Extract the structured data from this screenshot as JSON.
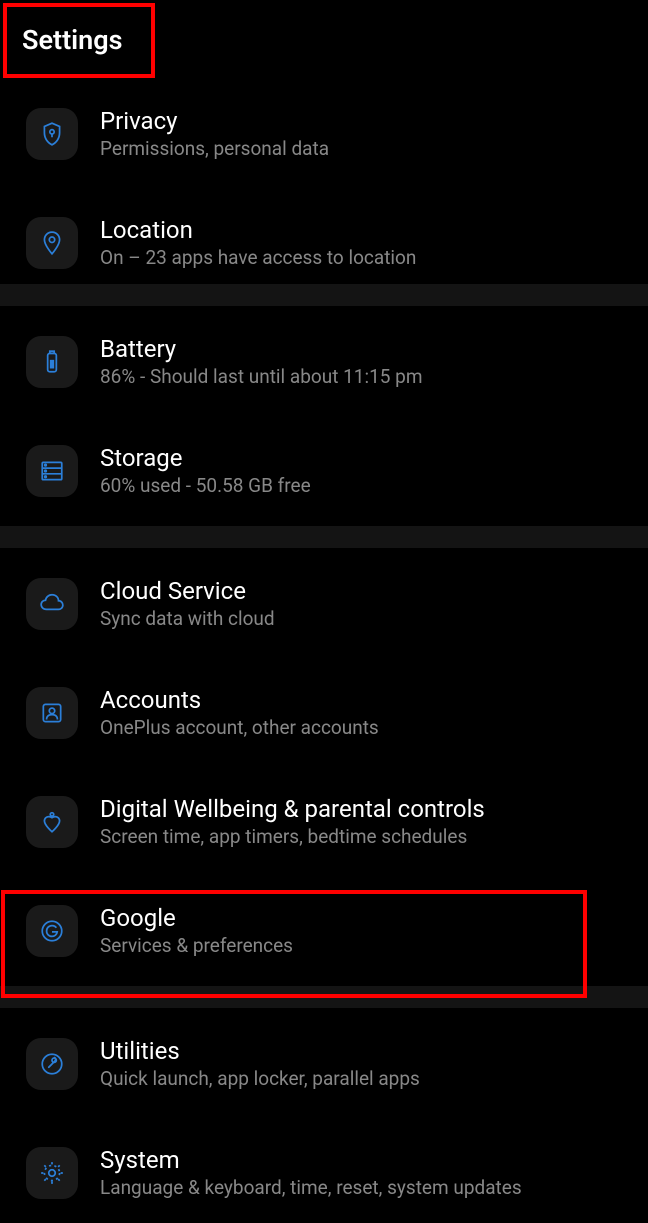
{
  "header": {
    "title": "Settings"
  },
  "groups": [
    {
      "items": [
        {
          "icon": "shield-keyhole",
          "title": "Privacy",
          "subtitle": "Permissions, personal data"
        },
        {
          "icon": "location-pin",
          "title": "Location",
          "subtitle": "On – 23 apps have access to location"
        }
      ]
    },
    {
      "items": [
        {
          "icon": "battery",
          "title": "Battery",
          "subtitle": "86% - Should last until about 11:15 pm"
        },
        {
          "icon": "storage",
          "title": "Storage",
          "subtitle": "60% used - 50.58 GB free"
        }
      ]
    },
    {
      "items": [
        {
          "icon": "cloud",
          "title": "Cloud Service",
          "subtitle": "Sync data with cloud"
        },
        {
          "icon": "accounts",
          "title": "Accounts",
          "subtitle": "OnePlus account, other accounts"
        },
        {
          "icon": "wellbeing",
          "title": "Digital Wellbeing & parental controls",
          "subtitle": "Screen time, app timers, bedtime schedules"
        },
        {
          "icon": "google",
          "title": "Google",
          "subtitle": "Services & preferences"
        }
      ]
    },
    {
      "items": [
        {
          "icon": "utilities",
          "title": "Utilities",
          "subtitle": "Quick launch, app locker, parallel apps"
        },
        {
          "icon": "system",
          "title": "System",
          "subtitle": "Language & keyboard, time, reset, system updates"
        }
      ]
    }
  ],
  "colors": {
    "icon": "#2b7fd9"
  }
}
